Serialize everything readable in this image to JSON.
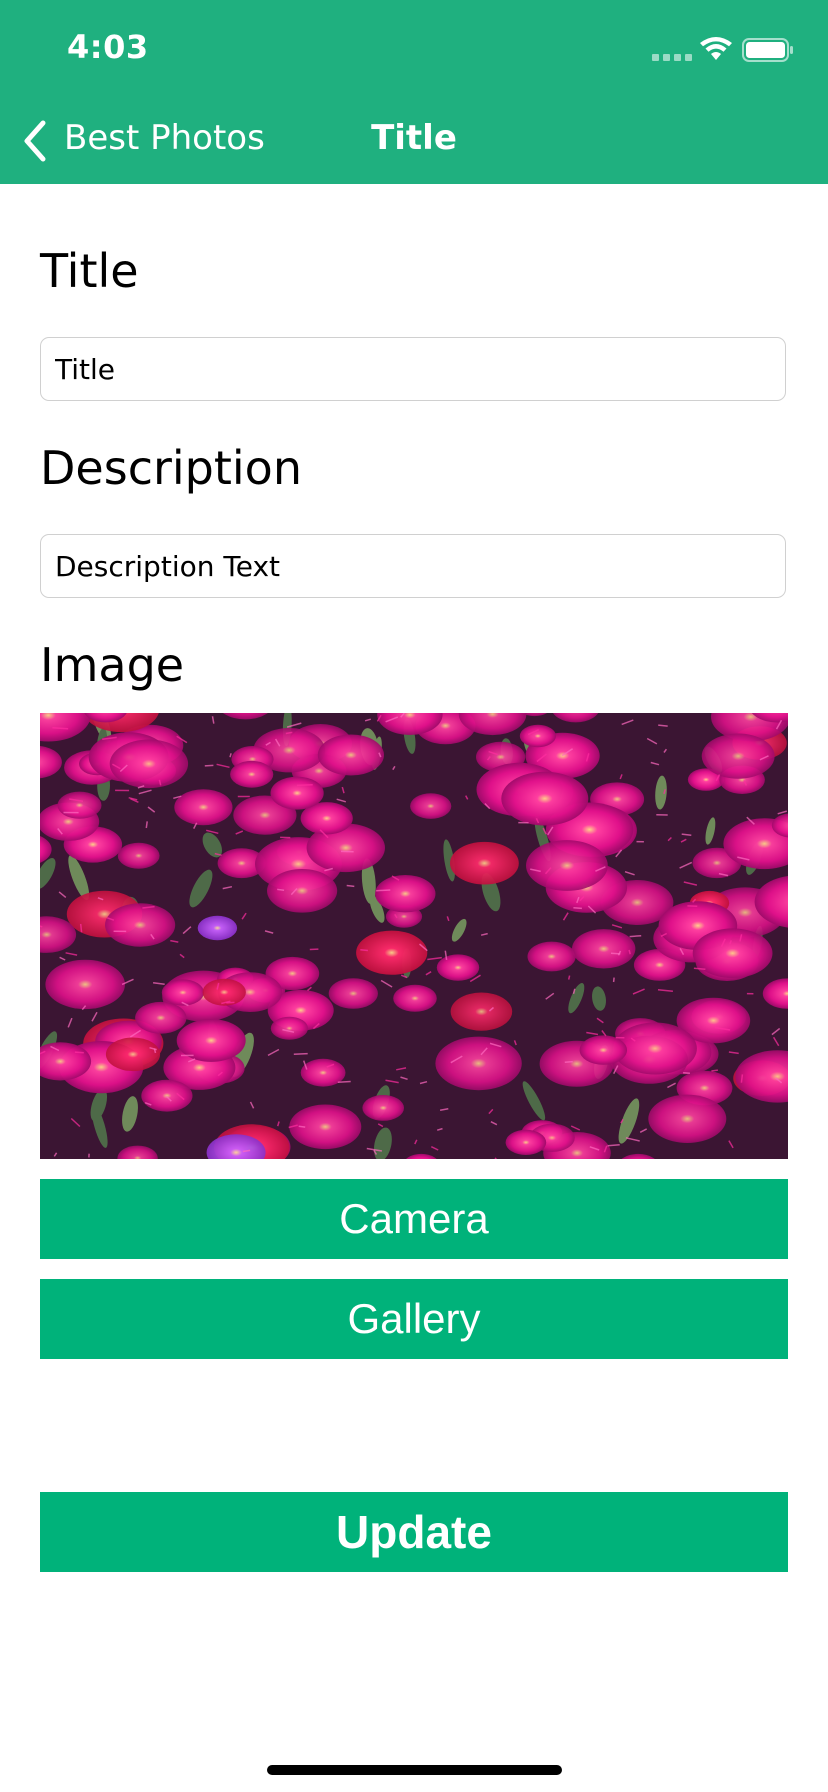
{
  "status_bar": {
    "time": "4:03"
  },
  "nav_bar": {
    "back_label": "Best Photos",
    "title": "Title",
    "background_color": "#1fb07f"
  },
  "form": {
    "title_label": "Title",
    "title_value": "Title",
    "description_label": "Description",
    "description_value": "Description Text",
    "image_label": "Image"
  },
  "image": {
    "content": "field of magenta ice plant flowers"
  },
  "buttons": {
    "camera_label": "Camera",
    "gallery_label": "Gallery",
    "update_label": "Update",
    "color": "#00b27a"
  },
  "icons": {
    "back": "chevron-left-icon",
    "wifi": "wifi-icon",
    "battery": "battery-icon",
    "cellular": "cellular-signal-icon"
  }
}
